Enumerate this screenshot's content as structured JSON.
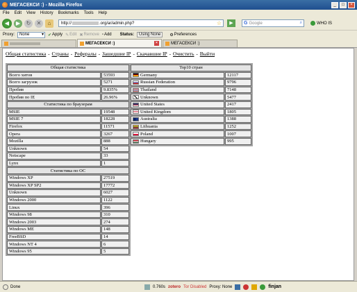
{
  "window": {
    "title": "МЕГАСЕКСИ :)  - Mozilla Firefox"
  },
  "menu": [
    "File",
    "Edit",
    "View",
    "History",
    "Bookmarks",
    "Tools",
    "Help"
  ],
  "nav": {
    "url_prefix": "http://",
    "url_suffix": ".org/ar/admin.php?",
    "search_placeholder": "Google",
    "whois_label": "WHO IS"
  },
  "proxybar": {
    "proxy_label": "Proxy:",
    "proxy_value": "None",
    "apply": "Apply",
    "edit": "Edit",
    "remove": "Remove",
    "add": "Add",
    "status_label": "Status:",
    "status_value": "Using None",
    "preferences": "Preferences"
  },
  "tabs": [
    {
      "label": "",
      "active": false
    },
    {
      "label": "МЕГАСЕКСИ :)",
      "active": true
    },
    {
      "label": "МЕГАСЕКСИ :)",
      "active": false
    }
  ],
  "topnav": [
    "Общая статистика",
    "Страны",
    "Рефералы",
    "Зашедшие IP",
    "Скачавшие IP",
    "Очистить",
    "Выйти"
  ],
  "general": {
    "header": "Общая статистика",
    "rows": [
      {
        "label": "Всего хитов",
        "value": "53593"
      },
      {
        "label": "Всего загрузок",
        "value": "5271"
      },
      {
        "label": "Пробив",
        "value": "9.835%"
      },
      {
        "label": "Пробив по IE",
        "value": "26.96%"
      }
    ]
  },
  "browsers": {
    "header": "Статистика по браузерам",
    "rows": [
      {
        "label": "MSIE",
        "value": "19548"
      },
      {
        "label": "MSIE 7",
        "value": "18228"
      },
      {
        "label": "Firefox",
        "value": "11571"
      },
      {
        "label": "Opera",
        "value": "3267"
      },
      {
        "label": "Mozilla",
        "value": "888"
      },
      {
        "label": "Unknown",
        "value": "54"
      },
      {
        "label": "Netscape",
        "value": "33"
      },
      {
        "label": "Lynx",
        "value": "1"
      }
    ]
  },
  "os": {
    "header": "Статистика по ОС",
    "rows": [
      {
        "label": "Windows XP",
        "value": "27519"
      },
      {
        "label": "Windows XP SP2",
        "value": "17772"
      },
      {
        "label": "Unknown",
        "value": "6027"
      },
      {
        "label": "Windows 2000",
        "value": "1122"
      },
      {
        "label": "Linux",
        "value": "396"
      },
      {
        "label": "Windows 98",
        "value": "310"
      },
      {
        "label": "Windows 2003",
        "value": "274"
      },
      {
        "label": "Windows ME",
        "value": "148"
      },
      {
        "label": "FreeBSD",
        "value": "14"
      },
      {
        "label": "Windows NT 4",
        "value": "6"
      },
      {
        "label": "Windows 95",
        "value": "5"
      }
    ]
  },
  "countries": {
    "header": "Top10 стран",
    "rows": [
      {
        "name": "Germany",
        "value": "12117",
        "flag": "de"
      },
      {
        "name": "Russian Federation",
        "value": "9796",
        "flag": "ru"
      },
      {
        "name": "Thailand",
        "value": "7148",
        "flag": "th"
      },
      {
        "name": "Unknown",
        "value": "5477",
        "flag": "xx"
      },
      {
        "name": "United States",
        "value": "2417",
        "flag": "us"
      },
      {
        "name": "United Kingdom",
        "value": "1805",
        "flag": "gb"
      },
      {
        "name": "Australia",
        "value": "1388",
        "flag": "au"
      },
      {
        "name": "Lithuania",
        "value": "1252",
        "flag": "lt"
      },
      {
        "name": "Poland",
        "value": "1007",
        "flag": "pl"
      },
      {
        "name": "Hungary",
        "value": "995",
        "flag": "hu"
      }
    ]
  },
  "statusbar": {
    "status": "Done",
    "timing": "0.760s",
    "zotero": "zotero",
    "tor": "Tor Disabled",
    "proxy": "Proxy: None",
    "finjan": "finjan"
  }
}
